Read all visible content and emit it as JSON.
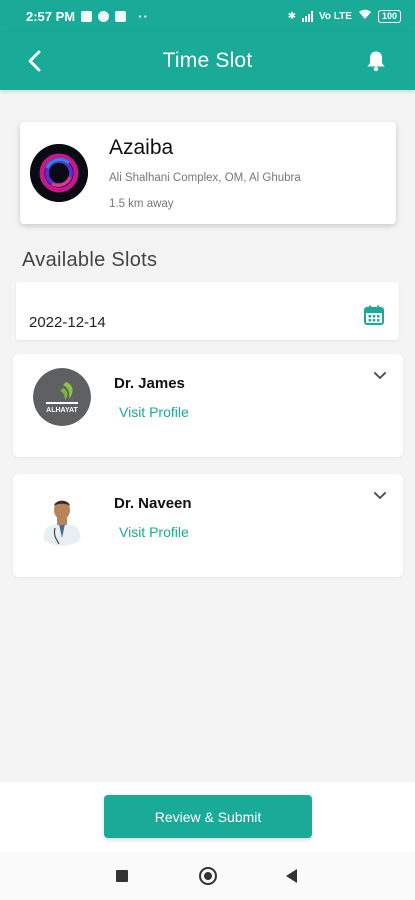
{
  "status_bar": {
    "time": "2:57 PM",
    "dots": "··",
    "network": "Vo LTE",
    "battery": "100"
  },
  "app_bar": {
    "title": "Time Slot",
    "back_icon": "back-arrow-icon",
    "bell_icon": "bell-icon"
  },
  "clinic": {
    "name": "Azaiba",
    "address": "Ali Shalhani Complex, OM, Al Ghubra",
    "distance": "1.5 km away"
  },
  "slots": {
    "title": "Available Slots",
    "date": "2022-12-14"
  },
  "doctors": [
    {
      "name": "Dr. James",
      "link": "Visit Profile",
      "avatar_text": "ALHAYAT"
    },
    {
      "name": "Dr. Naveen",
      "link": "Visit Profile"
    }
  ],
  "footer": {
    "submit_label": "Review & Submit"
  },
  "colors": {
    "primary": "#1aaa98",
    "background": "#f4f4f4"
  }
}
